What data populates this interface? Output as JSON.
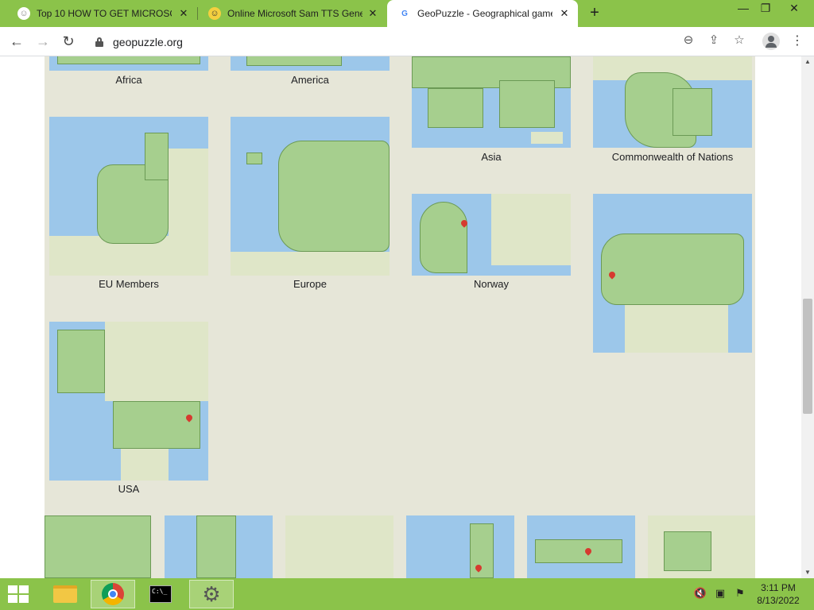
{
  "tabs": [
    {
      "title": "Top 10 HOW TO GET MICROSOF",
      "favicon": "smiley-sleep-icon"
    },
    {
      "title": "Online Microsoft Sam TTS Gene",
      "favicon": "smiley-icon"
    },
    {
      "title": "GeoPuzzle - Geographical game",
      "favicon": "geopuzzle-icon",
      "active": true
    }
  ],
  "toolbar": {
    "url": "geopuzzle.org"
  },
  "icons": {
    "back": "←",
    "forward": "→",
    "reload": "↻",
    "newtab": "+",
    "close": "✕",
    "minimize": "—",
    "maximize": "❐",
    "zoom": "⊖",
    "share": "⇪",
    "star": "☆",
    "menu": "⋮"
  },
  "maps": [
    {
      "label": "Africa"
    },
    {
      "label": "America"
    },
    {
      "label": "Asia"
    },
    {
      "label": "Commonwealth of Nations"
    },
    {
      "label": "EU Members"
    },
    {
      "label": "Europe"
    },
    {
      "label": "Norway"
    },
    {
      "label": ""
    },
    {
      "label": "USA"
    }
  ],
  "taskbar": {
    "clock_time": "3:11 PM",
    "clock_date": "8/13/2022",
    "cmd_text": "C:\\_"
  },
  "colors": {
    "accent": "#8bc34a",
    "panel": "#e6e6d8",
    "water": "#9cc7ea",
    "land": "#a6cf8e"
  }
}
